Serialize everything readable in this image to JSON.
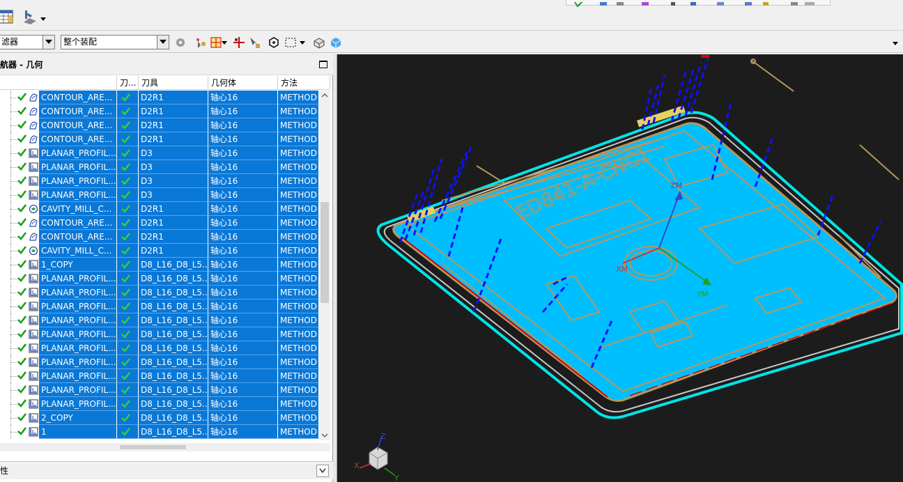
{
  "toolbar2": {
    "filter_combo": "滤器",
    "assembly_combo": "整个装配"
  },
  "navigator": {
    "title": "导航器 - 几何",
    "columns": [
      "刀...",
      "刀具",
      "几何体",
      "方法"
    ],
    "rows": [
      {
        "name": "CONTOUR_ARE...",
        "tool": "D2R1",
        "geom": "轴心16",
        "method": "METHOD",
        "op": "contour"
      },
      {
        "name": "CONTOUR_ARE...",
        "tool": "D2R1",
        "geom": "轴心16",
        "method": "METHOD",
        "op": "contour"
      },
      {
        "name": "CONTOUR_ARE...",
        "tool": "D2R1",
        "geom": "轴心16",
        "method": "METHOD",
        "op": "contour"
      },
      {
        "name": "CONTOUR_ARE...",
        "tool": "D2R1",
        "geom": "轴心16",
        "method": "METHOD",
        "op": "contour"
      },
      {
        "name": "PLANAR_PROFIL...",
        "tool": "D3",
        "geom": "轴心16",
        "method": "METHOD",
        "op": "planar"
      },
      {
        "name": "PLANAR_PROFIL...",
        "tool": "D3",
        "geom": "轴心16",
        "method": "METHOD",
        "op": "planar"
      },
      {
        "name": "PLANAR_PROFIL...",
        "tool": "D3",
        "geom": "轴心16",
        "method": "METHOD",
        "op": "planar"
      },
      {
        "name": "PLANAR_PROFIL...",
        "tool": "D3",
        "geom": "轴心16",
        "method": "METHOD",
        "op": "planar"
      },
      {
        "name": "CAVITY_MILL_C...",
        "tool": "D2R1",
        "geom": "轴心16",
        "method": "METHOD",
        "op": "cavity"
      },
      {
        "name": "CONTOUR_ARE...",
        "tool": "D2R1",
        "geom": "轴心16",
        "method": "METHOD",
        "op": "contour"
      },
      {
        "name": "CONTOUR_ARE...",
        "tool": "D2R1",
        "geom": "轴心16",
        "method": "METHOD",
        "op": "contour"
      },
      {
        "name": "CAVITY_MILL_C...",
        "tool": "D2R1",
        "geom": "轴心16",
        "method": "METHOD",
        "op": "cavity"
      },
      {
        "name": "1_COPY",
        "tool": "D8_L16_D8_L5...",
        "geom": "轴心16",
        "method": "METHOD",
        "op": "planar"
      },
      {
        "name": "PLANAR_PROFIL...",
        "tool": "D8_L16_D8_L5...",
        "geom": "轴心16",
        "method": "METHOD",
        "op": "planar"
      },
      {
        "name": "PLANAR_PROFIL...",
        "tool": "D8_L16_D8_L5...",
        "geom": "轴心16",
        "method": "METHOD",
        "op": "planar"
      },
      {
        "name": "PLANAR_PROFIL...",
        "tool": "D8_L16_D8_L5...",
        "geom": "轴心16",
        "method": "METHOD",
        "op": "planar"
      },
      {
        "name": "PLANAR_PROFIL...",
        "tool": "D8_L16_D8_L5...",
        "geom": "轴心16",
        "method": "METHOD",
        "op": "planar"
      },
      {
        "name": "PLANAR_PROFIL...",
        "tool": "D8_L16_D8_L5...",
        "geom": "轴心16",
        "method": "METHOD",
        "op": "planar"
      },
      {
        "name": "PLANAR_PROFIL...",
        "tool": "D8_L16_D8_L5...",
        "geom": "轴心16",
        "method": "METHOD",
        "op": "planar"
      },
      {
        "name": "PLANAR_PROFIL...",
        "tool": "D8_L16_D8_L5...",
        "geom": "轴心16",
        "method": "METHOD",
        "op": "planar"
      },
      {
        "name": "PLANAR_PROFIL...",
        "tool": "D8_L16_D8_L5...",
        "geom": "轴心16",
        "method": "METHOD",
        "op": "planar"
      },
      {
        "name": "PLANAR_PROFIL...",
        "tool": "D8_L16_D8_L5...",
        "geom": "轴心16",
        "method": "METHOD",
        "op": "planar"
      },
      {
        "name": "PLANAR_PROFIL...",
        "tool": "D8_L16_D8_L5...",
        "geom": "轴心16",
        "method": "METHOD",
        "op": "planar"
      },
      {
        "name": "2_COPY",
        "tool": "D8_L16_D8_L5...",
        "geom": "轴心16",
        "method": "METHOD",
        "op": "planar"
      },
      {
        "name": "1",
        "tool": "D8_L16_D8_L5...",
        "geom": "轴心16",
        "method": "METHOD",
        "op": "planar"
      }
    ]
  },
  "properties_bar": {
    "label": "性"
  },
  "viewport": {
    "part_label": "ED841-A-CNC1",
    "wcs_axes": {
      "z": "ZM",
      "x": "XM",
      "y": "YM"
    },
    "triad_axes": {
      "z": "Z",
      "x": "X",
      "y": "Y"
    },
    "colors": {
      "background": "#1c1c1c",
      "part": "#00bfff",
      "toolpath": "#1010ff",
      "outline": "#b8975a",
      "rim": "#00e5e5"
    }
  }
}
